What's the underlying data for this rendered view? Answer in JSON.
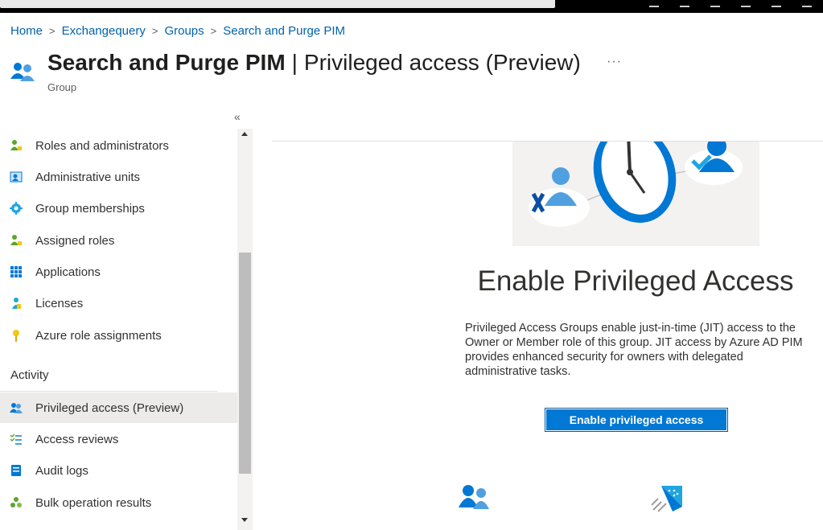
{
  "breadcrumb": {
    "items": [
      "Home",
      "Exchangequery",
      "Groups",
      "Search and Purge PIM"
    ],
    "separator": ">"
  },
  "header": {
    "name": "Search and Purge PIM",
    "page": "Privileged access (Preview)",
    "pipe": "|",
    "subtitle": "Group",
    "more": "···",
    "icon": "group-icon"
  },
  "sidebar": {
    "collapse": "«",
    "items": [
      {
        "label": "Roles and administrators",
        "icon": "roles-icon"
      },
      {
        "label": "Administrative units",
        "icon": "admin-units-icon"
      },
      {
        "label": "Group memberships",
        "icon": "gear-icon"
      },
      {
        "label": "Assigned roles",
        "icon": "assigned-roles-icon"
      },
      {
        "label": "Applications",
        "icon": "applications-grid-icon"
      },
      {
        "label": "Licenses",
        "icon": "licenses-icon"
      },
      {
        "label": "Azure role assignments",
        "icon": "key-icon"
      }
    ],
    "activity_header": "Activity",
    "activity_items": [
      {
        "label": "Privileged access (Preview)",
        "icon": "privileged-access-icon",
        "selected": true
      },
      {
        "label": "Access reviews",
        "icon": "access-reviews-icon"
      },
      {
        "label": "Audit logs",
        "icon": "audit-logs-icon"
      },
      {
        "label": "Bulk operation results",
        "icon": "bulk-operations-icon"
      }
    ]
  },
  "content": {
    "title": "Enable Privileged Access",
    "description": "Privileged Access Groups enable just-in-time (JIT) access to the Owner or Member role of this group. JIT access by Azure AD PIM provides enhanced security for owners with delegated administrative tasks.",
    "button": "Enable privileged access"
  },
  "colors": {
    "accent": "#0078d4",
    "link": "#0062ad",
    "selected_bg": "#edebe9"
  }
}
